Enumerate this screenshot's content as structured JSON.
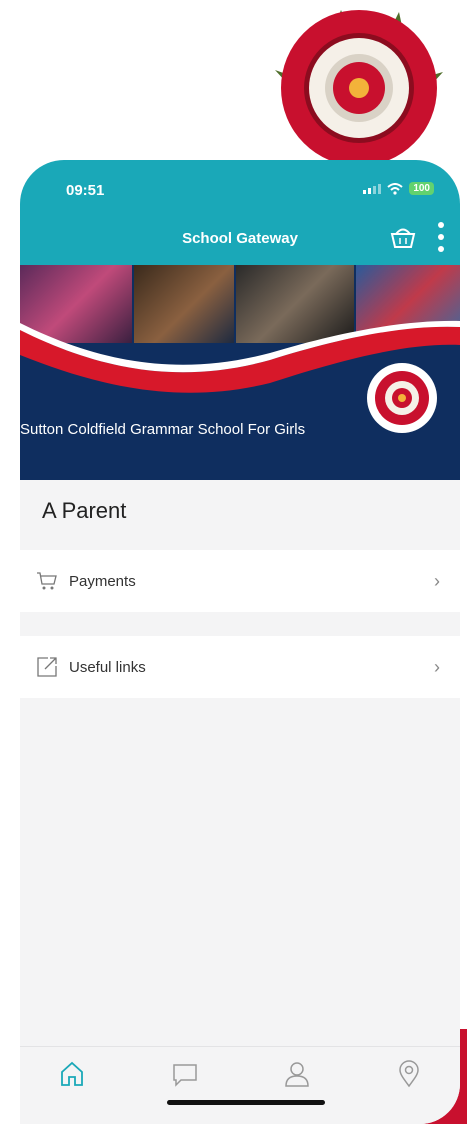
{
  "status_bar": {
    "time": "09:51",
    "battery": "100"
  },
  "header": {
    "title": "School Gateway"
  },
  "banner": {
    "school_name": "Sutton Coldfield Grammar School For Girls"
  },
  "user": {
    "name": "A Parent"
  },
  "menu": [
    {
      "label": "Payments",
      "icon": "shopping-cart-icon"
    },
    {
      "label": "Useful links",
      "icon": "external-link-icon"
    }
  ],
  "tabs": [
    "home-icon",
    "messages-icon",
    "profile-icon",
    "location-icon"
  ],
  "colors": {
    "header": "#1aa8b8",
    "banner": "#0f2e5f",
    "accent": "#c8102e",
    "tab_active": "#1aa8b8"
  }
}
